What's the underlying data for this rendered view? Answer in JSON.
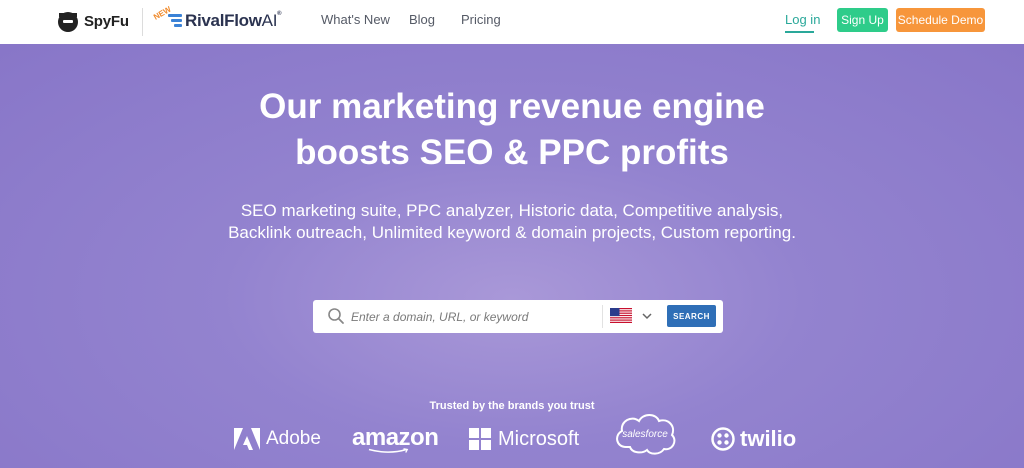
{
  "nav": {
    "spyfu_brand": "SpyFu",
    "rivalflow_new": "NEW",
    "rivalflow_brand": "RivalFlow",
    "rivalflow_ai": "AI",
    "links": [
      "What's New",
      "Blog",
      "Pricing"
    ],
    "login": "Log in",
    "signup": "Sign Up",
    "demo": "Schedule Demo"
  },
  "hero": {
    "headline_line1": "Our marketing revenue engine",
    "headline_line2": "boosts SEO & PPC profits",
    "subhead": "SEO marketing suite, PPC analyzer, Historic data, Competitive analysis, Backlink outreach, Unlimited keyword & domain projects, Custom reporting."
  },
  "search": {
    "placeholder": "Enter a domain, URL, or keyword",
    "country_flag": "us-flag-icon",
    "button": "SEARCH"
  },
  "brands": {
    "heading": "Trusted by the brands you trust",
    "items": [
      "Adobe",
      "amazon",
      "Microsoft",
      "salesforce",
      "twilio"
    ]
  },
  "colors": {
    "hero_bg": "#8f7fcc",
    "signup_green": "#2ecc8a",
    "demo_orange": "#f7963b",
    "search_blue": "#2f6fb7",
    "login_teal": "#2aa89a"
  }
}
